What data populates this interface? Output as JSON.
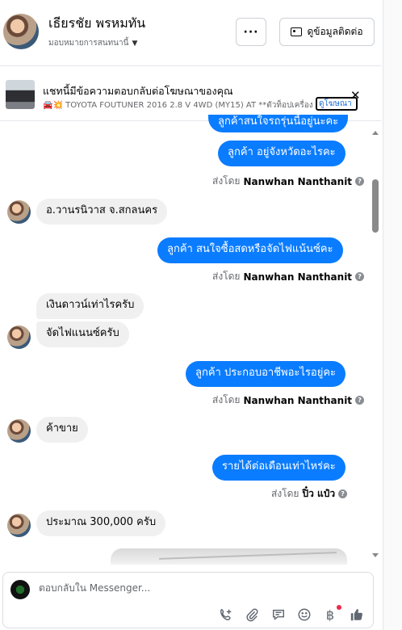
{
  "header": {
    "name": "เธียรชัย พรหมทัน",
    "assignee": "มอบหมายการสนทนานี้",
    "more_label": "···",
    "contact_label": "ดูข้อมูลติดต่อ"
  },
  "ad": {
    "title": "แชทนี้มีข้อความตอบกลับต่อโฆษณาของคุณ",
    "description": "🚘💥 TOYOTA FOUTUNER 2016 2.8 V 4WD (MY15) AT **ตัวท็อปเครื่อง",
    "link_label": "ดูโฆษณา",
    "close_label": "✕"
  },
  "messages": {
    "m1_partial": "ลูกค้าสนใจรถรุ่นนี้อยู่นะคะ",
    "m2": "ลูกค้า อยู่จังหวัดอะไรคะ",
    "sent1_prefix": "ส่งโดย",
    "sent1_name": "Nanwhan Nanthanit",
    "m3": "อ.วานรนิวาส จ.สกลนคร",
    "m4": "ลูกค้า สนใจซื้อสดหรือจัดไฟแน้นซ์คะ",
    "sent2_prefix": "ส่งโดย",
    "sent2_name": "Nanwhan Nanthanit",
    "m5": "เงินดาวน์เท่าไรครับ",
    "m6": "จัดไฟแนนซ์ครับ",
    "m7": "ลูกค้า ประกอบอาชีพอะไรอยู่คะ",
    "sent3_prefix": "ส่งโดย",
    "sent3_name": "Nanwhan Nanthanit",
    "m8": "ค้าขาย",
    "m9": "รายได้ต่อเดือนเท่าไหร่คะ",
    "sent4_prefix": "ส่งโดย",
    "sent4_name": "ปิ๋ว แป๋ว",
    "m10": "ประมาณ 300,000 ครับ"
  },
  "composer": {
    "placeholder": "ตอบกลับใน Messenger..."
  },
  "icons": [
    "phone-add-icon",
    "paperclip-icon",
    "saved-reply-icon",
    "emoji-icon",
    "baht-icon",
    "thumbs-up-icon"
  ],
  "colors": {
    "outgoing_bubble": "#0a7cff",
    "incoming_bubble": "#f0f0f0",
    "notification_dot": "#f02849"
  }
}
